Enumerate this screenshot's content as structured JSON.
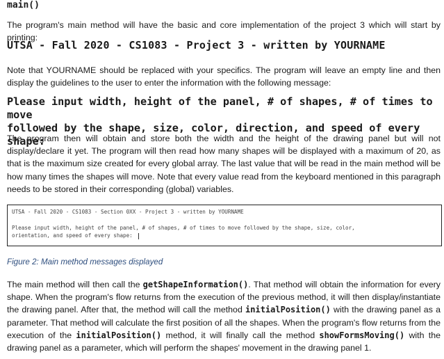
{
  "heading": "main()",
  "paragraphs": {
    "p1": "The program's main method will have the basic and core implementation of the project 3 which will start by printing:",
    "p2": "Note that YOURNAME should be replaced with your specifics. The program will leave an empty line and then display the guidelines to the user to enter the information with the following message:",
    "p3": "The program then will obtain and store both the width and the height of the drawing panel but will not display/declare it yet. The program will then read how many shapes will be displayed with a maximum of 20, as that is the maximum size created for every global array. The last value that will be read in the main method will be how many times the shapes will move. Note that every value read from the keyboard mentioned in this paragraph needs to be stored in their corresponding (global) variables.",
    "p4_part1": "The main method will then call the ",
    "p4_code1": "getShapeInformation()",
    "p4_part2": ". That method will obtain the information for every shape. When the program's flow returns from the execution of the previous method, it will then display/instantiate the drawing panel. After that, the method will call the method ",
    "p4_code2": "initialPosition()",
    "p4_part3": " with the drawing panel as a parameter. That method will calculate the first position of all the shapes. When the program's flow returns from the execution of the ",
    "p4_code3": "initialPosition()",
    "p4_part4": " method, it will finally call the method ",
    "p4_code4": "showFormsMoving()",
    "p4_part5": " with the drawing panel as a parameter, which will perform the shapes' movement in the drawing panel 1."
  },
  "code": {
    "line1": "UTSA - Fall 2020 - CS1083 - Project 3 - written by YOURNAME",
    "line2a": "Please input width, height of the panel, # of shapes, # of times to move",
    "line2b": "followed by the shape, size, color, direction, and speed of every shape:"
  },
  "console": {
    "line1": "UTSA - Fall 2020 - CS1083 - Section 0XX - Project 3 - written by YOURNAME",
    "line2": "Please input width, height of the panel, # of shapes, # of times to move followed by the shape, size, color,",
    "line3": "orientation, and speed of every shape:"
  },
  "caption": "Figure 2: Main method messages displayed",
  "colors": {
    "caption": "#2e4e7e",
    "watermark": "#e9e9e9"
  }
}
